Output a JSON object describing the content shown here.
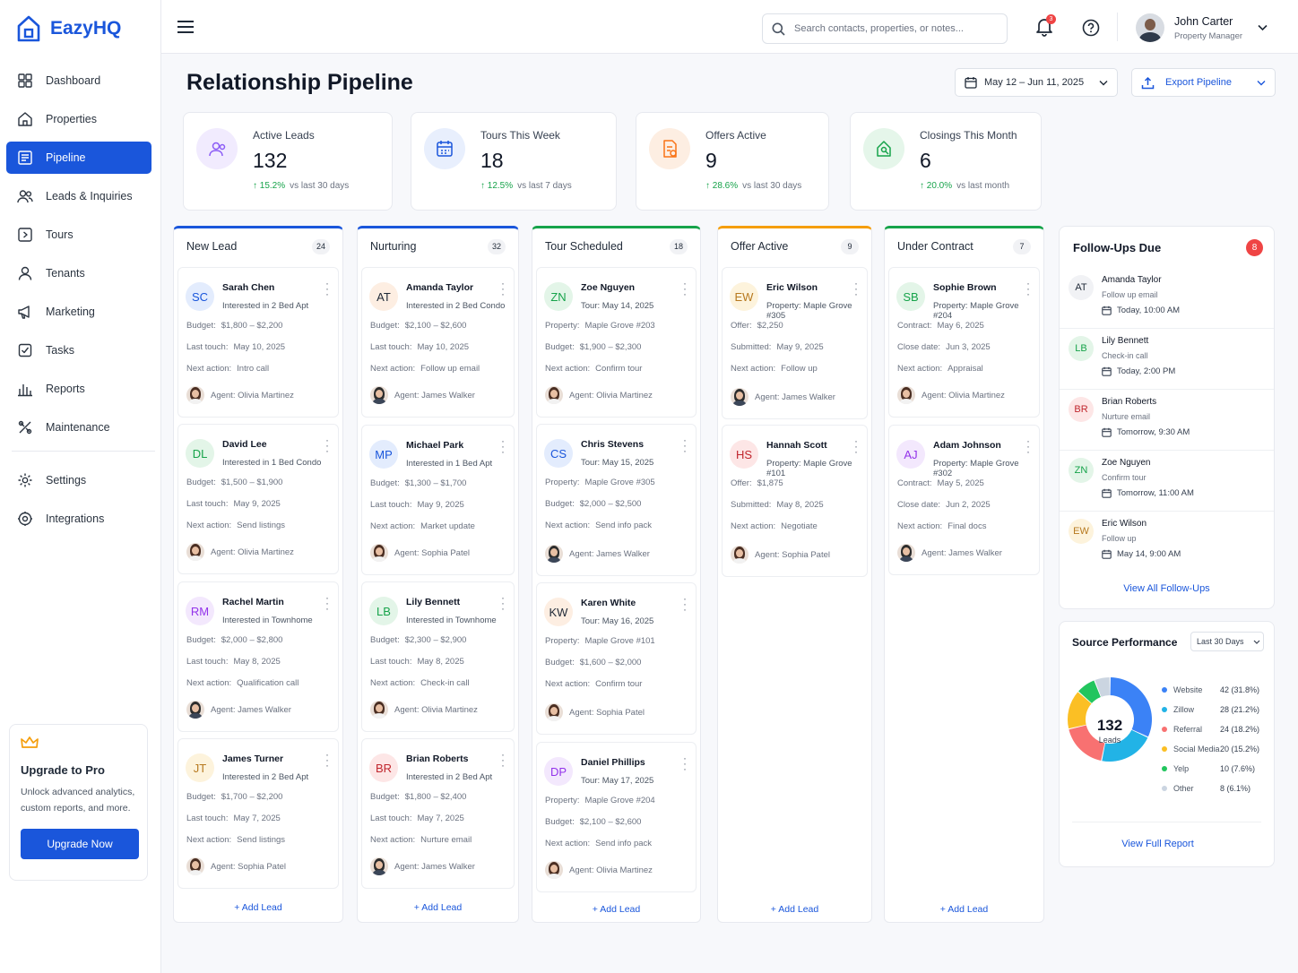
{
  "app": {
    "name": "EazyHQ"
  },
  "sidebar": {
    "items": [
      {
        "label": "Dashboard",
        "icon": "grid-icon"
      },
      {
        "label": "Properties",
        "icon": "home-icon"
      },
      {
        "label": "Pipeline",
        "icon": "pipeline-icon",
        "active": true
      },
      {
        "label": "Leads & Inquiries",
        "icon": "users-icon"
      },
      {
        "label": "Tours",
        "icon": "tour-icon"
      },
      {
        "label": "Tenants",
        "icon": "user-icon"
      },
      {
        "label": "Marketing",
        "icon": "megaphone-icon"
      },
      {
        "label": "Tasks",
        "icon": "checkbox-icon"
      },
      {
        "label": "Reports",
        "icon": "bar-chart-icon"
      },
      {
        "label": "Maintenance",
        "icon": "tools-icon"
      }
    ],
    "bottom": [
      {
        "label": "Settings",
        "icon": "gear-icon"
      },
      {
        "label": "Integrations",
        "icon": "integrations-icon"
      }
    ],
    "upgrade": {
      "title": "Upgrade to Pro",
      "text": "Unlock advanced analytics, custom reports, and more.",
      "button": "Upgrade Now"
    }
  },
  "topbar": {
    "search_placeholder": "Search contacts, properties, or notes...",
    "notifications": "3",
    "user_name": "John Carter",
    "user_role": "Property Manager"
  },
  "page": {
    "title": "Relationship Pipeline",
    "date_range": "May 12 – Jun 11, 2025",
    "export": "Export Pipeline"
  },
  "stats": [
    {
      "label": "Active Leads",
      "value": "132",
      "change": "15.2%",
      "period": "vs last 30 days",
      "color": "#8b5cf6",
      "bg": "#f1ebfe"
    },
    {
      "label": "Tours This Week",
      "value": "18",
      "change": "12.5%",
      "period": "vs last 7 days",
      "color": "#1a56db",
      "bg": "#e8effd"
    },
    {
      "label": "Offers Active",
      "value": "9",
      "change": "28.6%",
      "period": "vs last 30 days",
      "color": "#f97316",
      "bg": "#fdeee2"
    },
    {
      "label": "Closings This Month",
      "value": "6",
      "change": "20.0%",
      "period": "vs last month",
      "color": "#16a34a",
      "bg": "#e5f6ea"
    }
  ],
  "columns": [
    {
      "title": "New Lead",
      "count": "24",
      "color": "#1a56db",
      "add": "+ Add Lead",
      "cards": [
        {
          "initials": "SC",
          "name": "Sarah Chen",
          "sub": "Interested in 2 Bed Apt",
          "rows": [
            [
              "Budget:",
              "$1,800 – $2,200"
            ],
            [
              "Last touch:",
              "May 10, 2025"
            ],
            [
              "Next action:",
              "Intro call"
            ]
          ],
          "agent": "Agent: Olivia Martinez",
          "avbg": "#e3ecfd",
          "avfg": "#1a56db"
        },
        {
          "initials": "DL",
          "name": "David Lee",
          "sub": "Interested in 1 Bed Condo",
          "rows": [
            [
              "Budget:",
              "$1,500 – $1,900"
            ],
            [
              "Last touch:",
              "May 9, 2025"
            ],
            [
              "Next action:",
              "Send listings"
            ]
          ],
          "agent": "Agent: Olivia Martinez",
          "avbg": "#e3f5e8",
          "avfg": "#16a34a"
        },
        {
          "initials": "RM",
          "name": "Rachel Martin",
          "sub": "Interested in Townhome",
          "rows": [
            [
              "Budget:",
              "$2,000 – $2,800"
            ],
            [
              "Last touch:",
              "May 8, 2025"
            ],
            [
              "Next action:",
              "Qualification call"
            ]
          ],
          "agent": "Agent: James Walker",
          "avbg": "#f3e8fd",
          "avfg": "#9333ea"
        },
        {
          "initials": "JT",
          "name": "James Turner",
          "sub": "Interested in 2 Bed Apt",
          "rows": [
            [
              "Budget:",
              "$1,700 – $2,200"
            ],
            [
              "Last touch:",
              "May 7, 2025"
            ],
            [
              "Next action:",
              "Send listings"
            ]
          ],
          "agent": "Agent: Sophia Patel",
          "avbg": "#fdf3dc",
          "avfg": "#b7791f"
        }
      ]
    },
    {
      "title": "Nurturing",
      "count": "32",
      "color": "#1a56db",
      "add": "+ Add Lead",
      "cards": [
        {
          "initials": "AT",
          "name": "Amanda Taylor",
          "sub": "Interested in 2 Bed Condo",
          "rows": [
            [
              "Budget:",
              "$2,100 – $2,600"
            ],
            [
              "Last touch:",
              "May 10, 2025"
            ],
            [
              "Next action:",
              "Follow up email"
            ]
          ],
          "agent": "Agent: James Walker",
          "avbg": "#fdeee2",
          "avfg": "#1f2937"
        },
        {
          "initials": "MP",
          "name": "Michael Park",
          "sub": "Interested in 1 Bed Apt",
          "rows": [
            [
              "Budget:",
              "$1,300 – $1,700"
            ],
            [
              "Last touch:",
              "May 9, 2025"
            ],
            [
              "Next action:",
              "Market update"
            ]
          ],
          "agent": "Agent: Sophia Patel",
          "avbg": "#e3ecfd",
          "avfg": "#1a56db"
        },
        {
          "initials": "LB",
          "name": "Lily Bennett",
          "sub": "Interested in Townhome",
          "rows": [
            [
              "Budget:",
              "$2,300 – $2,900"
            ],
            [
              "Last touch:",
              "May 8, 2025"
            ],
            [
              "Next action:",
              "Check-in call"
            ]
          ],
          "agent": "Agent: Olivia Martinez",
          "avbg": "#e3f5e8",
          "avfg": "#16a34a"
        },
        {
          "initials": "BR",
          "name": "Brian Roberts",
          "sub": "Interested in 2 Bed Apt",
          "rows": [
            [
              "Budget:",
              "$1,800 – $2,400"
            ],
            [
              "Last touch:",
              "May 7, 2025"
            ],
            [
              "Next action:",
              "Nurture email"
            ]
          ],
          "agent": "Agent: James Walker",
          "avbg": "#fde6e6",
          "avfg": "#c0262d"
        }
      ]
    },
    {
      "title": "Tour Scheduled",
      "count": "18",
      "color": "#16a34a",
      "add": "+ Add Lead",
      "cards": [
        {
          "initials": "ZN",
          "name": "Zoe Nguyen",
          "sub": "Tour: May 14, 2025",
          "rows": [
            [
              "Property:",
              "Maple Grove #203"
            ],
            [
              "Budget:",
              "$1,900 – $2,300"
            ],
            [
              "Next action:",
              "Confirm tour"
            ]
          ],
          "agent": "Agent: Olivia Martinez",
          "avbg": "#e3f5e8",
          "avfg": "#16a34a"
        },
        {
          "initials": "CS",
          "name": "Chris Stevens",
          "sub": "Tour: May 15, 2025",
          "rows": [
            [
              "Property:",
              "Maple Grove #305"
            ],
            [
              "Budget:",
              "$2,000 – $2,500"
            ],
            [
              "Next action:",
              "Send info pack"
            ]
          ],
          "agent": "Agent: James Walker",
          "avbg": "#e3ecfd",
          "avfg": "#1a56db"
        },
        {
          "initials": "KW",
          "name": "Karen White",
          "sub": "Tour: May 16, 2025",
          "rows": [
            [
              "Property:",
              "Maple Grove #101"
            ],
            [
              "Budget:",
              "$1,600 – $2,000"
            ],
            [
              "Next action:",
              "Confirm tour"
            ]
          ],
          "agent": "Agent: Sophia Patel",
          "avbg": "#fdeee2",
          "avfg": "#1f2937"
        },
        {
          "initials": "DP",
          "name": "Daniel Phillips",
          "sub": "Tour: May 17, 2025",
          "rows": [
            [
              "Property:",
              "Maple Grove #204"
            ],
            [
              "Budget:",
              "$2,100 – $2,600"
            ],
            [
              "Next action:",
              "Send info pack"
            ]
          ],
          "agent": "Agent: Olivia Martinez",
          "avbg": "#f3e8fd",
          "avfg": "#9333ea"
        }
      ]
    },
    {
      "title": "Offer Active",
      "count": "9",
      "color": "#f59e0b",
      "add": "+ Add Lead",
      "cards": [
        {
          "initials": "EW",
          "name": "Eric Wilson",
          "sub": "Property: Maple Grove #305",
          "rows": [
            [
              "Offer:",
              "$2,250"
            ],
            [
              "Submitted:",
              "May 9, 2025"
            ],
            [
              "Next action:",
              "Follow up"
            ]
          ],
          "agent": "Agent: James Walker",
          "avbg": "#fdf3dc",
          "avfg": "#b7791f"
        },
        {
          "initials": "HS",
          "name": "Hannah Scott",
          "sub": "Property: Maple Grove #101",
          "rows": [
            [
              "Offer:",
              "$1,875"
            ],
            [
              "Submitted:",
              "May 8, 2025"
            ],
            [
              "Next action:",
              "Negotiate"
            ]
          ],
          "agent": "Agent: Sophia Patel",
          "avbg": "#fde6e6",
          "avfg": "#c0262d"
        }
      ]
    },
    {
      "title": "Under Contract",
      "count": "7",
      "color": "#16a34a",
      "add": "+ Add Lead",
      "cards": [
        {
          "initials": "SB",
          "name": "Sophie Brown",
          "sub": "Property: Maple Grove #204",
          "rows": [
            [
              "Contract:",
              "May 6, 2025"
            ],
            [
              "Close date:",
              "Jun 3, 2025"
            ],
            [
              "Next action:",
              "Appraisal"
            ]
          ],
          "agent": "Agent: Olivia Martinez",
          "avbg": "#e3f5e8",
          "avfg": "#16a34a"
        },
        {
          "initials": "AJ",
          "name": "Adam Johnson",
          "sub": "Property: Maple Grove #302",
          "rows": [
            [
              "Contract:",
              "May 5, 2025"
            ],
            [
              "Close date:",
              "Jun 2, 2025"
            ],
            [
              "Next action:",
              "Final docs"
            ]
          ],
          "agent": "Agent: James Walker",
          "avbg": "#f3e8fd",
          "avfg": "#9333ea"
        }
      ]
    }
  ],
  "followups": {
    "title": "Follow-Ups Due",
    "count": "8",
    "link": "View All Follow-Ups",
    "items": [
      {
        "initials": "AT",
        "name": "Amanda Taylor",
        "task": "Follow up email",
        "when": "Today, 10:00 AM",
        "bg": "#f1f2f5",
        "fg": "#1f2937"
      },
      {
        "initials": "LB",
        "name": "Lily Bennett",
        "task": "Check-in call",
        "when": "Today, 2:00 PM",
        "bg": "#e3f5e8",
        "fg": "#16a34a"
      },
      {
        "initials": "BR",
        "name": "Brian Roberts",
        "task": "Nurture email",
        "when": "Tomorrow, 9:30 AM",
        "bg": "#fde6e6",
        "fg": "#c0262d"
      },
      {
        "initials": "ZN",
        "name": "Zoe Nguyen",
        "task": "Confirm tour",
        "when": "Tomorrow, 11:00 AM",
        "bg": "#e3f5e8",
        "fg": "#16a34a"
      },
      {
        "initials": "EW",
        "name": "Eric Wilson",
        "task": "Follow up",
        "when": "May 14, 9:00 AM",
        "bg": "#fdf3dc",
        "fg": "#b7791f"
      }
    ]
  },
  "source": {
    "title": "Source Performance",
    "filter": "Last 30 Days",
    "center_value": "132",
    "center_label": "Leads",
    "link": "View Full Report"
  },
  "chart_data": {
    "type": "pie",
    "title": "Source Performance",
    "categories": [
      "Website",
      "Zillow",
      "Referral",
      "Social Media",
      "Yelp",
      "Other"
    ],
    "values": [
      42,
      28,
      24,
      20,
      10,
      8
    ],
    "labels": [
      "42 (31.8%)",
      "28 (21.2%)",
      "24 (18.2%)",
      "20 (15.2%)",
      "10 (7.6%)",
      "8 (6.1%)"
    ],
    "colors": [
      "#3b82f6",
      "#22b3e6",
      "#f87171",
      "#fbbf24",
      "#22c55e",
      "#cbd5e1"
    ]
  }
}
